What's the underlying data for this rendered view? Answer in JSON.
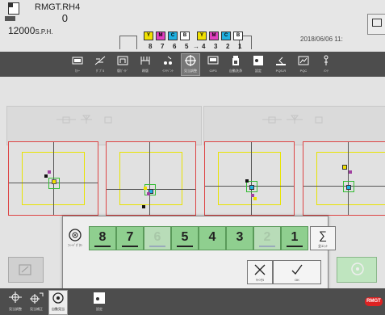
{
  "header": {
    "job_name": "RMGT.RH4",
    "counter": "0",
    "speed_value": "12000",
    "speed_unit": "S.P.H.",
    "date": "2018/06/06 11:"
  },
  "unit_indicator": {
    "numbers": [
      "8",
      "7",
      "6",
      "5",
      "4",
      "3",
      "2",
      "1"
    ],
    "color_boxes": [
      {
        "letter": "Y",
        "color": "#f0e000"
      },
      {
        "letter": "M",
        "color": "#e040c0"
      },
      {
        "letter": "C",
        "color": "#20b0e0"
      },
      {
        "letter": "B",
        "color": "#ffffff"
      },
      {
        "letter": "Y",
        "color": "#f0e000"
      },
      {
        "letter": "M",
        "color": "#e040c0"
      },
      {
        "letter": "C",
        "color": "#20b0e0"
      },
      {
        "letter": "B",
        "color": "#ffffff"
      }
    ]
  },
  "toolbar": {
    "items": [
      {
        "icon": "grid-icon",
        "label": "ｶﾗｰ"
      },
      {
        "icon": "tilted-square-icon",
        "label": "ﾀﾞﾌﾞﾙ"
      },
      {
        "icon": "plate-icon",
        "label": "版ｶﾞｲﾄﾞ"
      },
      {
        "icon": "press-icon",
        "label": "刷版"
      },
      {
        "icon": "roller-icon",
        "label": "ｲﾝｷﾍﾟﾝﾄ"
      },
      {
        "icon": "crosshair-icon",
        "label": "見当調整"
      },
      {
        "icon": "monitor-icon",
        "label": "CIP3"
      },
      {
        "icon": "bottle-icon",
        "label": "自動洗浄"
      },
      {
        "icon": "dot-icon",
        "label": "設定"
      },
      {
        "icon": "page-icon",
        "label": "PQS-R"
      },
      {
        "icon": "chart-icon",
        "label": "PQC"
      },
      {
        "icon": "tools-icon",
        "label": "ﾒﾝﾃ"
      }
    ]
  },
  "modal": {
    "dial_label": "ﾌｨｰﾄﾞﾎﾞﾀﾝ",
    "units": [
      {
        "num": "8",
        "active": true
      },
      {
        "num": "7",
        "active": true
      },
      {
        "num": "6",
        "active": false
      },
      {
        "num": "5",
        "active": true
      },
      {
        "num": "4",
        "active": true
      },
      {
        "num": "3",
        "active": true
      },
      {
        "num": "2",
        "active": false
      },
      {
        "num": "1",
        "active": true
      }
    ],
    "all_label": "全ﾕﾆｯﾄ",
    "cancel_label": "ｷｬﾝｾﾙ",
    "ok_label": "OK"
  },
  "statusbar": {
    "items": [
      {
        "icon": "plate-adjust-icon",
        "label": "見当調整"
      },
      {
        "icon": "crosshair-plus-icon",
        "label": "見当補正"
      },
      {
        "icon": "dial-icon",
        "label": "自動見当"
      },
      {
        "icon": "dot-icon",
        "label": "設定"
      }
    ],
    "logo_text": "RMGT"
  },
  "colors": {
    "toolbar_bg": "#4d4d4d",
    "unit_key": "#8fcf8f",
    "crop_red": "#dd4444",
    "guide_yellow": "#e8e400",
    "register_green": "#33bb33",
    "logo_red": "#d22"
  }
}
